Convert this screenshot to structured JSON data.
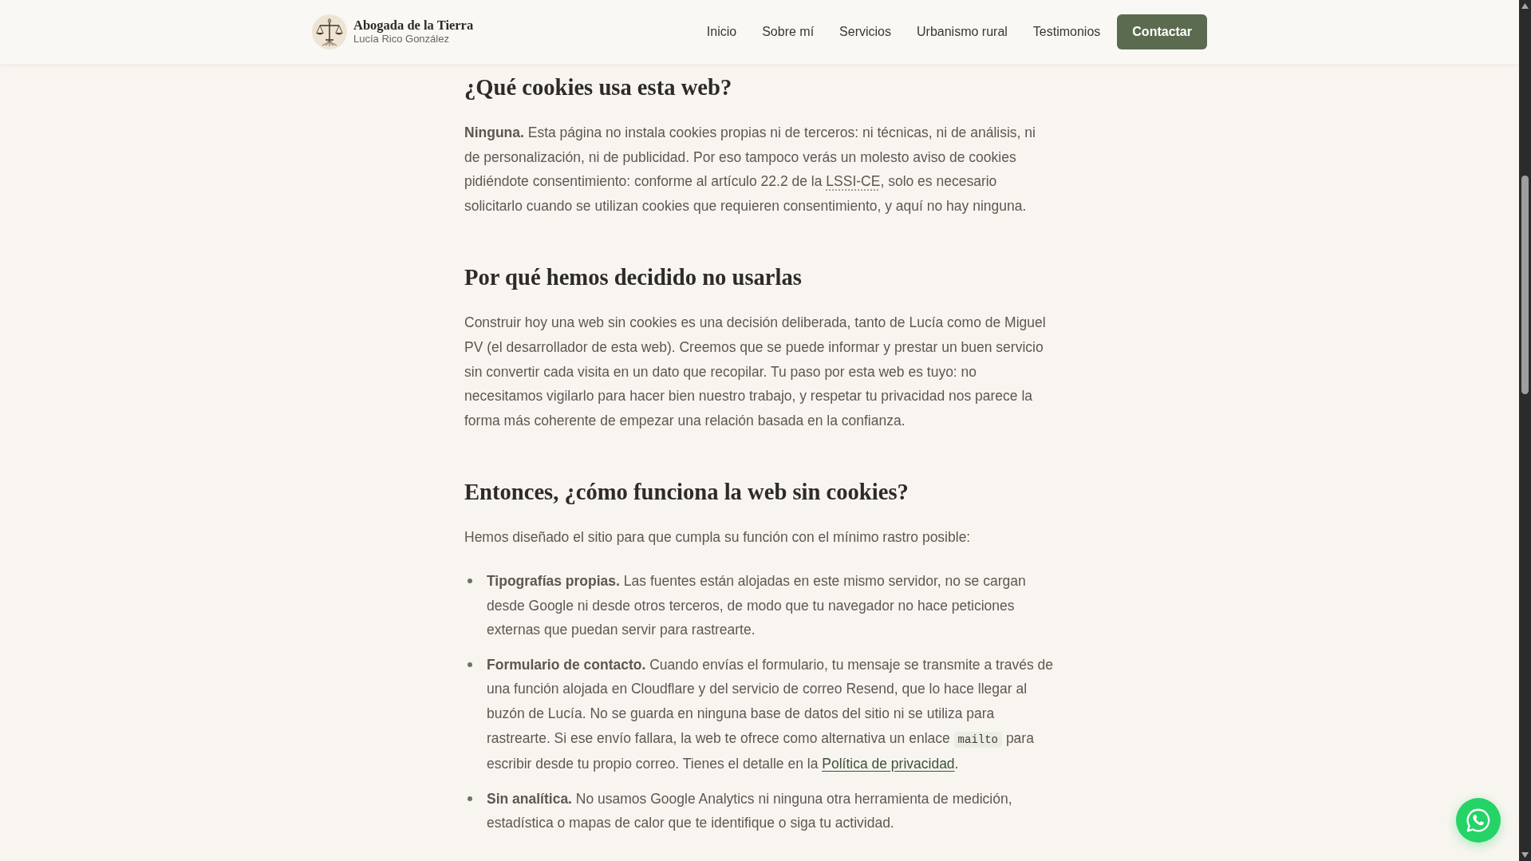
{
  "header": {
    "brand": {
      "title": "Abogada de la Tierra",
      "subtitle": "Lucía Rico González"
    },
    "nav": [
      {
        "label": "Inicio"
      },
      {
        "label": "Sobre mí"
      },
      {
        "label": "Servicios"
      },
      {
        "label": "Urbanismo rural"
      },
      {
        "label": "Testimonios"
      }
    ],
    "cta_button": "Contactar"
  },
  "sections": [
    {
      "heading": "¿Qué cookies usa esta web?",
      "blocks": [
        {
          "kind": "paragraph",
          "parts": [
            {
              "kind": "text",
              "text": "**Ninguna.** Esta página no instala cookies propias ni de terceros: ni técnicas, ni de análisis, ni de personalización, ni de publicidad. Por eso tampoco verás un molesto aviso de cookies pidiéndote consentimiento: conforme al artículo 22.2 de la "
            },
            {
              "kind": "abbr",
              "text": "LSSI-CE"
            },
            {
              "kind": "text",
              "text": ", solo es necesario solicitarlo cuando se utilizan cookies que requieren consentimiento, y aquí no hay ninguna."
            }
          ]
        }
      ]
    },
    {
      "heading": "Por qué hemos decidido no usarlas",
      "blocks": [
        {
          "kind": "paragraph",
          "parts": [
            {
              "kind": "text",
              "text": "Construir hoy una web sin cookies es una decisión deliberada, tanto de Lucía como de Miguel PV (el desarrollador de esta web). Creemos que se puede informar y prestar un buen servicio sin convertir cada visita en un dato que recopilar. Tu paso por esta web es tuyo: no necesitamos vigilarlo para hacer bien nuestro trabajo, y respetar tu privacidad nos parece la forma más coherente de empezar una relación basada en la confianza."
            }
          ]
        }
      ]
    },
    {
      "heading": "Entonces, ¿cómo funciona la web sin cookies?",
      "blocks": [
        {
          "kind": "paragraph",
          "parts": [
            {
              "kind": "text",
              "text": "Hemos diseñado el sitio para que cumpla su función con el mínimo rastro posible:"
            }
          ]
        },
        {
          "kind": "list",
          "items": [
            {
              "parts": [
                {
                  "kind": "text",
                  "text": "**Tipografías propias.** Las fuentes están alojadas en este mismo servidor, no se cargan desde Google ni desde otros terceros, de modo que tu navegador no hace peticiones externas que puedan servir para rastrearte."
                }
              ]
            },
            {
              "parts": [
                {
                  "kind": "text",
                  "text": "**Formulario de contacto.** Cuando envías el formulario, tu mensaje se transmite a través de una función alojada en Cloudflare y del servicio de correo Resend, que lo hace llegar al buzón de Lucía. No se guarda en ninguna base de datos del sitio ni se utiliza para rastrearte. Si ese envío fallara, la web te ofrece como alternativa un enlace "
                },
                {
                  "kind": "code",
                  "text": "mailto"
                },
                {
                  "kind": "text",
                  "text": " para escribir desde tu propio correo. Tienes el detalle en la "
                },
                {
                  "kind": "link",
                  "text": "Política de privacidad"
                },
                {
                  "kind": "text",
                  "text": "."
                }
              ]
            },
            {
              "parts": [
                {
                  "kind": "text",
                  "text": "**Sin analítica.** No usamos Google Analytics ni ninguna otra herramienta de medición, estadística o mapas de calor que te identifique o siga tu actividad."
                }
              ]
            }
          ]
        }
      ]
    }
  ]
}
